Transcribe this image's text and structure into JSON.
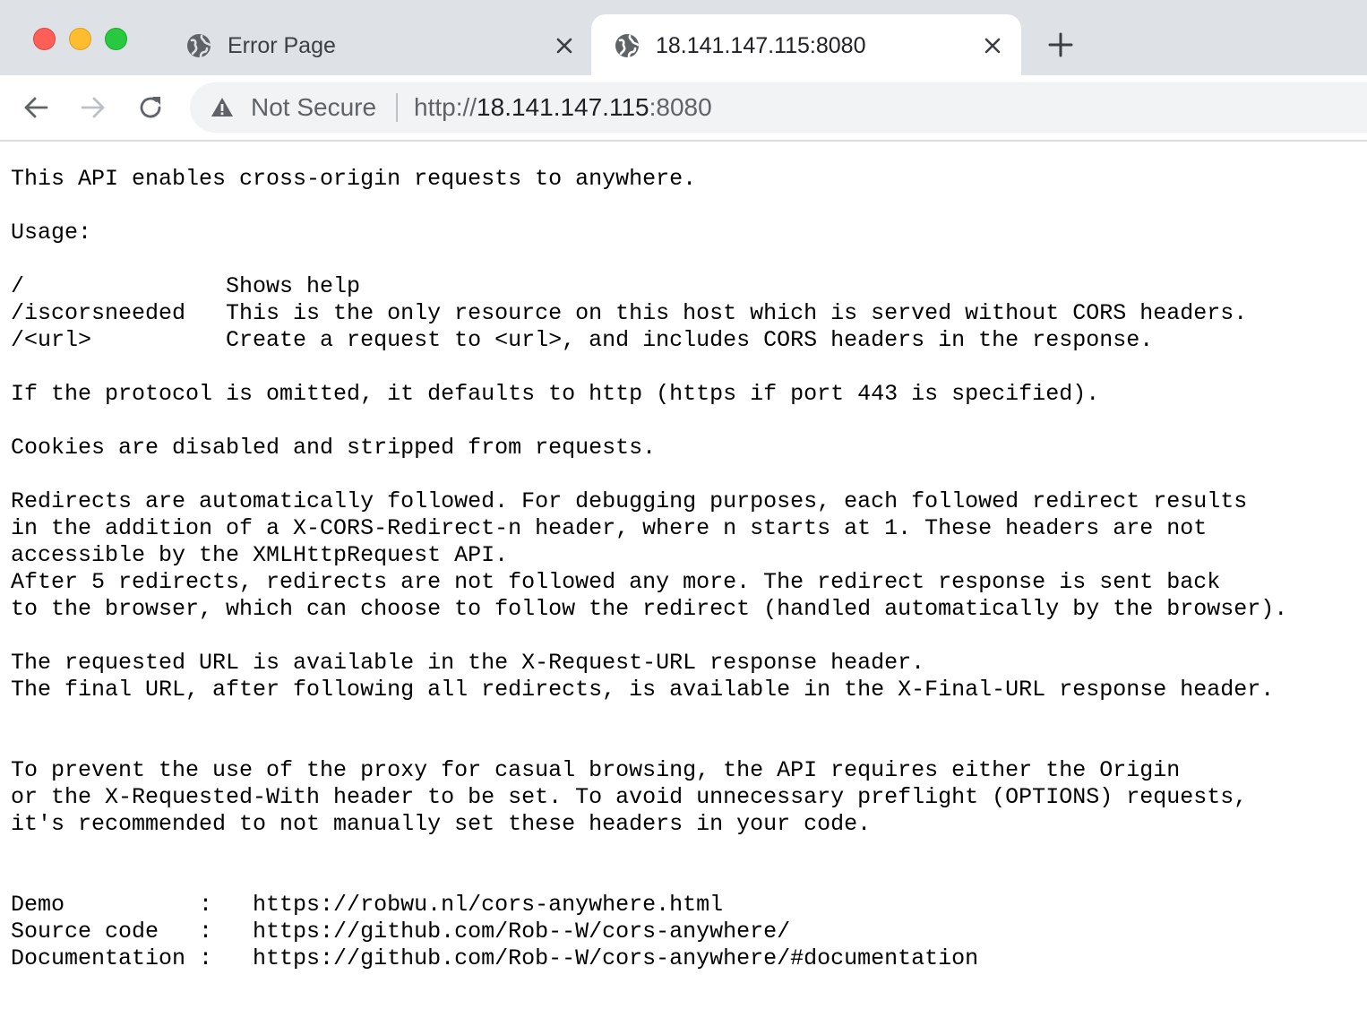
{
  "window": {
    "traffic_lights": {
      "close": "#ff5f57",
      "minimize": "#febc2e",
      "zoom": "#28c840"
    }
  },
  "tabs": [
    {
      "title": "Error Page",
      "icon": "globe-icon",
      "active": false
    },
    {
      "title": "18.141.147.115:8080",
      "icon": "globe-icon",
      "active": true
    }
  ],
  "toolbar": {
    "security_label": "Not Secure",
    "url_scheme": "http://",
    "url_host": "18.141.147.115",
    "url_port": ":8080"
  },
  "page": {
    "text": "This API enables cross-origin requests to anywhere.\n\nUsage:\n\n/               Shows help\n/iscorsneeded   This is the only resource on this host which is served without CORS headers.\n/<url>          Create a request to <url>, and includes CORS headers in the response.\n\nIf the protocol is omitted, it defaults to http (https if port 443 is specified).\n\nCookies are disabled and stripped from requests.\n\nRedirects are automatically followed. For debugging purposes, each followed redirect results\nin the addition of a X-CORS-Redirect-n header, where n starts at 1. These headers are not\naccessible by the XMLHttpRequest API.\nAfter 5 redirects, redirects are not followed any more. The redirect response is sent back\nto the browser, which can choose to follow the redirect (handled automatically by the browser).\n\nThe requested URL is available in the X-Request-URL response header.\nThe final URL, after following all redirects, is available in the X-Final-URL response header.\n\n\nTo prevent the use of the proxy for casual browsing, the API requires either the Origin\nor the X-Requested-With header to be set. To avoid unnecessary preflight (OPTIONS) requests,\nit's recommended to not manually set these headers in your code.\n\n\nDemo          :   https://robwu.nl/cors-anywhere.html\nSource code   :   https://github.com/Rob--W/cors-anywhere/\nDocumentation :   https://github.com/Rob--W/cors-anywhere/#documentation"
  }
}
